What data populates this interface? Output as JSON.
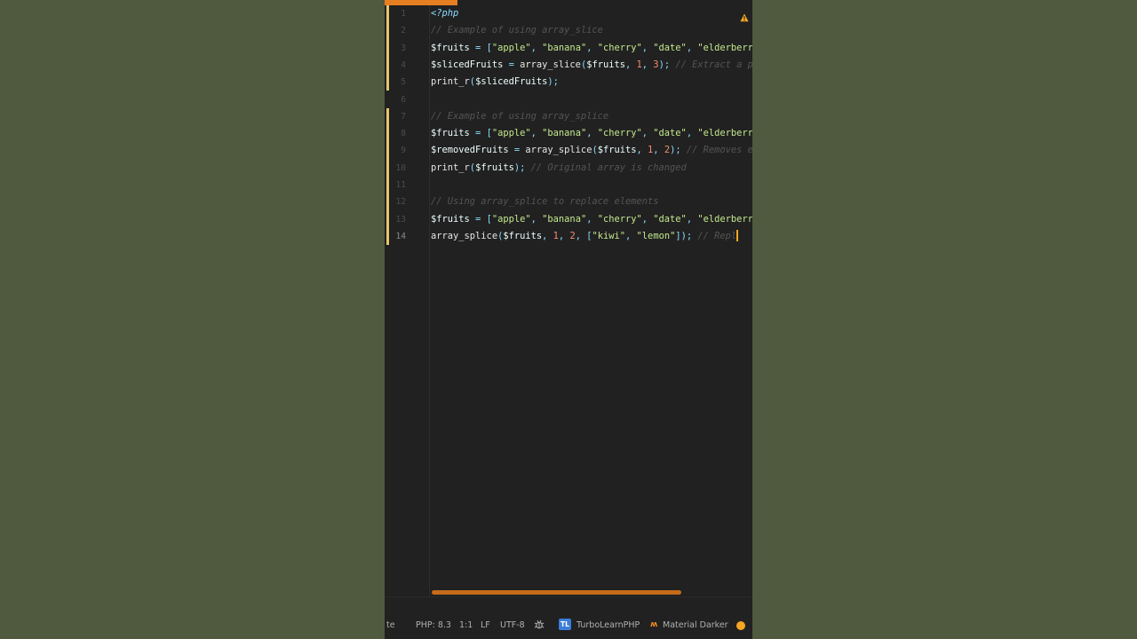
{
  "editor": {
    "lines": [
      {
        "no": "1",
        "tokens": [
          {
            "t": "<?php",
            "c": "kw-tag"
          }
        ]
      },
      {
        "no": "2",
        "tokens": [
          {
            "t": "// Example of using array_slice",
            "c": "cm"
          }
        ]
      },
      {
        "no": "3",
        "tokens": [
          {
            "t": "$fruits",
            "c": "var"
          },
          {
            "t": " = ",
            "c": "pun"
          },
          {
            "t": "[",
            "c": "pun"
          },
          {
            "t": "\"apple\"",
            "c": "str"
          },
          {
            "t": ", ",
            "c": "pun"
          },
          {
            "t": "\"banana\"",
            "c": "str"
          },
          {
            "t": ", ",
            "c": "pun"
          },
          {
            "t": "\"cherry\"",
            "c": "str"
          },
          {
            "t": ", ",
            "c": "pun"
          },
          {
            "t": "\"date\"",
            "c": "str"
          },
          {
            "t": ", ",
            "c": "pun"
          },
          {
            "t": "\"elderberry\"",
            "c": "str"
          },
          {
            "t": "]",
            "c": "pun"
          }
        ]
      },
      {
        "no": "4",
        "tokens": [
          {
            "t": "$slicedFruits",
            "c": "var"
          },
          {
            "t": " = ",
            "c": "pun"
          },
          {
            "t": "array_slice",
            "c": "fn"
          },
          {
            "t": "(",
            "c": "pun"
          },
          {
            "t": "$fruits",
            "c": "var"
          },
          {
            "t": ", ",
            "c": "pun"
          },
          {
            "t": "1",
            "c": "num"
          },
          {
            "t": ", ",
            "c": "pun"
          },
          {
            "t": "3",
            "c": "num"
          },
          {
            "t": "); ",
            "c": "pun"
          },
          {
            "t": "// Extract a port",
            "c": "cm"
          }
        ]
      },
      {
        "no": "5",
        "tokens": [
          {
            "t": "print_r",
            "c": "fn"
          },
          {
            "t": "(",
            "c": "pun"
          },
          {
            "t": "$slicedFruits",
            "c": "var"
          },
          {
            "t": ");",
            "c": "pun"
          }
        ]
      },
      {
        "no": "6",
        "tokens": []
      },
      {
        "no": "7",
        "tokens": [
          {
            "t": "// Example of using array_splice",
            "c": "cm"
          }
        ]
      },
      {
        "no": "8",
        "tokens": [
          {
            "t": "$fruits",
            "c": "var"
          },
          {
            "t": " = ",
            "c": "pun"
          },
          {
            "t": "[",
            "c": "pun"
          },
          {
            "t": "\"apple\"",
            "c": "str"
          },
          {
            "t": ", ",
            "c": "pun"
          },
          {
            "t": "\"banana\"",
            "c": "str"
          },
          {
            "t": ", ",
            "c": "pun"
          },
          {
            "t": "\"cherry\"",
            "c": "str"
          },
          {
            "t": ", ",
            "c": "pun"
          },
          {
            "t": "\"date\"",
            "c": "str"
          },
          {
            "t": ", ",
            "c": "pun"
          },
          {
            "t": "\"elderberry\"",
            "c": "str"
          },
          {
            "t": "]",
            "c": "pun"
          }
        ]
      },
      {
        "no": "9",
        "tokens": [
          {
            "t": "$removedFruits",
            "c": "var"
          },
          {
            "t": " = ",
            "c": "pun"
          },
          {
            "t": "array_splice",
            "c": "fn"
          },
          {
            "t": "(",
            "c": "pun"
          },
          {
            "t": "$fruits",
            "c": "var"
          },
          {
            "t": ", ",
            "c": "pun"
          },
          {
            "t": "1",
            "c": "num"
          },
          {
            "t": ", ",
            "c": "pun"
          },
          {
            "t": "2",
            "c": "num"
          },
          {
            "t": "); ",
            "c": "pun"
          },
          {
            "t": "// Removes elem",
            "c": "cm"
          }
        ]
      },
      {
        "no": "10",
        "tokens": [
          {
            "t": "print_r",
            "c": "fn"
          },
          {
            "t": "(",
            "c": "pun"
          },
          {
            "t": "$fruits",
            "c": "var"
          },
          {
            "t": "); ",
            "c": "pun"
          },
          {
            "t": "// Original array is changed",
            "c": "cm"
          }
        ]
      },
      {
        "no": "11",
        "tokens": []
      },
      {
        "no": "12",
        "tokens": [
          {
            "t": "// Using array_splice to replace elements",
            "c": "cm"
          }
        ]
      },
      {
        "no": "13",
        "tokens": [
          {
            "t": "$fruits",
            "c": "var"
          },
          {
            "t": " = ",
            "c": "pun"
          },
          {
            "t": "[",
            "c": "pun"
          },
          {
            "t": "\"apple\"",
            "c": "str"
          },
          {
            "t": ", ",
            "c": "pun"
          },
          {
            "t": "\"banana\"",
            "c": "str"
          },
          {
            "t": ", ",
            "c": "pun"
          },
          {
            "t": "\"cherry\"",
            "c": "str"
          },
          {
            "t": ", ",
            "c": "pun"
          },
          {
            "t": "\"date\"",
            "c": "str"
          },
          {
            "t": ", ",
            "c": "pun"
          },
          {
            "t": "\"elderberry\"",
            "c": "str"
          },
          {
            "t": "]",
            "c": "pun"
          }
        ]
      },
      {
        "no": "14",
        "tokens": [
          {
            "t": "array_splice",
            "c": "fn"
          },
          {
            "t": "(",
            "c": "pun"
          },
          {
            "t": "$fruits",
            "c": "var"
          },
          {
            "t": ", ",
            "c": "pun"
          },
          {
            "t": "1",
            "c": "num"
          },
          {
            "t": ", ",
            "c": "pun"
          },
          {
            "t": "2",
            "c": "num"
          },
          {
            "t": ", [",
            "c": "pun"
          },
          {
            "t": "\"kiwi\"",
            "c": "str"
          },
          {
            "t": ", ",
            "c": "pun"
          },
          {
            "t": "\"lemon\"",
            "c": "str"
          },
          {
            "t": "]); ",
            "c": "pun"
          },
          {
            "t": "// Repl",
            "c": "cm"
          }
        ]
      }
    ],
    "active_line": "14",
    "warning_icon": "warning-icon"
  },
  "status_bar": {
    "left_fragment": "te",
    "php_version": "PHP: 8.3",
    "cursor_pos": "1:1",
    "line_ending": "LF",
    "encoding": "UTF-8",
    "plugin_badge": "TL",
    "plugin_name": "TurboLearnPHP",
    "theme_name": "Material Darker",
    "status_dot_color": "#f5a623"
  },
  "colors": {
    "background": "#4f5a3f",
    "editor_bg": "#212121",
    "accent": "#e67e22"
  }
}
